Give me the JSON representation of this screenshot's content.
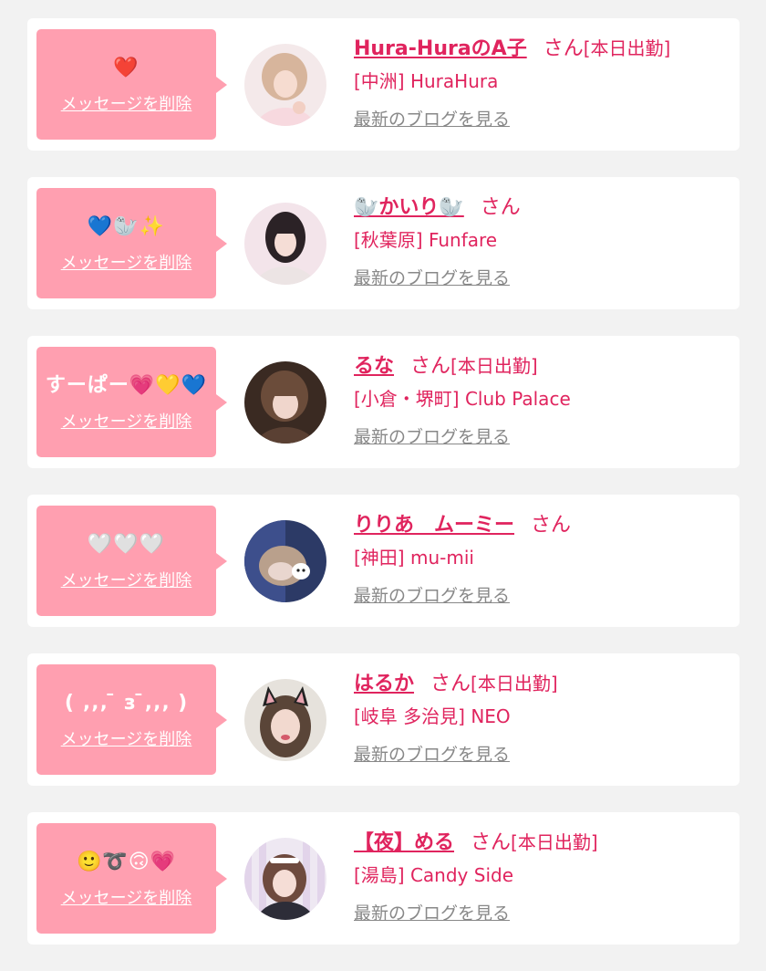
{
  "colors": {
    "page_bg": "#f2f2f2",
    "card_bg": "#ffffff",
    "bubble_bg": "#ff9fb0",
    "accent": "#e0245e",
    "link_gray": "#888888"
  },
  "cards": [
    {
      "message": "❤️",
      "delete_label": "メッセージを削除",
      "name": "Hura-HuraのA子",
      "honorific": "さん",
      "status": "[本日出勤]",
      "shop": "[中洲] HuraHura",
      "blog_label": "最新のブログを見る",
      "avatar_icon": "girl-photo-icon"
    },
    {
      "message": "💙🦭✨",
      "delete_label": "メッセージを削除",
      "name": "🦭かいり🦭",
      "honorific": "さん",
      "status": "",
      "shop": "[秋葉原] Funfare",
      "blog_label": "最新のブログを見る",
      "avatar_icon": "girl-photo-icon"
    },
    {
      "message": "すーぱー💗💛💙",
      "delete_label": "メッセージを削除",
      "name": "るな",
      "honorific": "さん",
      "status": "[本日出勤]",
      "shop": "[小倉・堺町] Club Palace",
      "blog_label": "最新のブログを見る",
      "avatar_icon": "girl-photo-icon"
    },
    {
      "message": "🤍🤍🤍",
      "delete_label": "メッセージを削除",
      "name": "りりあ　ムーミー",
      "honorific": "さん",
      "status": "",
      "shop": "[神田] mu-mii",
      "blog_label": "最新のブログを見る",
      "avatar_icon": "girl-photo-icon"
    },
    {
      "message": "( ‚‚‚ ̄ з ̄‚‚‚ )",
      "delete_label": "メッセージを削除",
      "name": "はるか",
      "honorific": "さん",
      "status": "[本日出勤]",
      "shop": "[岐阜 多治見] NEO",
      "blog_label": "最新のブログを見る",
      "avatar_icon": "girl-photo-icon"
    },
    {
      "message": "🙂➰🙃💗",
      "delete_label": "メッセージを削除",
      "name": "【夜】める",
      "honorific": "さん",
      "status": "[本日出勤]",
      "shop": "[湯島] Candy Side",
      "blog_label": "最新のブログを見る",
      "avatar_icon": "girl-photo-icon"
    }
  ]
}
